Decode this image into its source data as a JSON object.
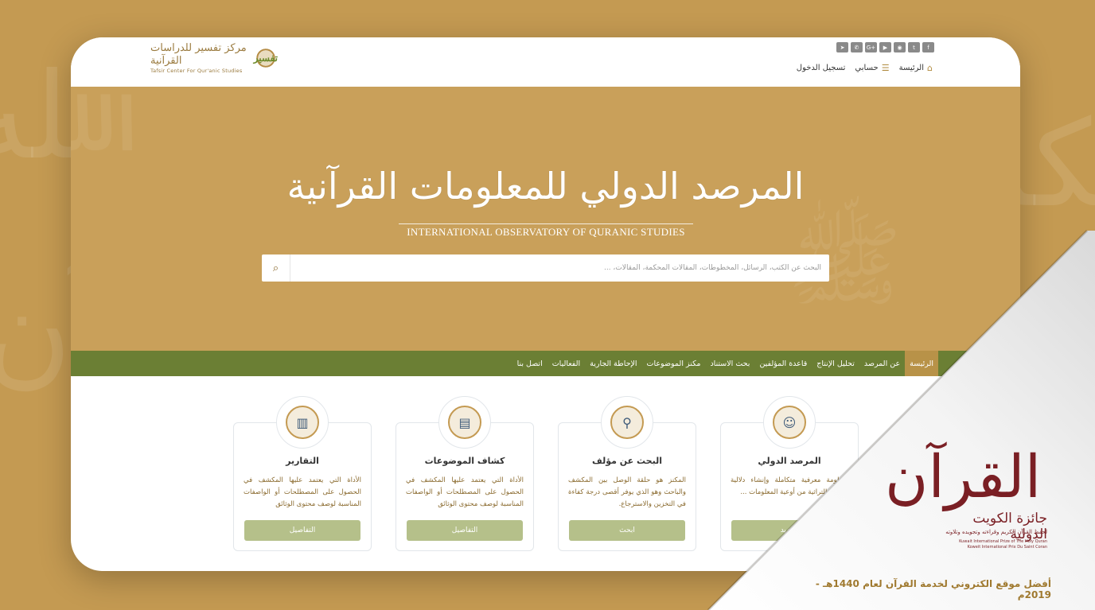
{
  "header": {
    "logo": {
      "arabic": "مركز تفسير للدراسات القرآنية",
      "english": "Tafsir Center For Qur'anic Studies",
      "emblem": "تفسير"
    },
    "social_icons": [
      "facebook-icon",
      "twitter-icon",
      "rss-icon",
      "youtube-icon",
      "google-plus-icon",
      "whatsapp-icon",
      "telegram-icon"
    ],
    "social_glyphs": {
      "facebook": "f",
      "twitter": "t",
      "rss": "◉",
      "youtube": "▶",
      "google_plus": "G+",
      "whatsapp": "✆",
      "telegram": "➤"
    },
    "links": {
      "home": "الرئيسة",
      "account": "حسابي",
      "login": "تسجيل الدخول"
    }
  },
  "hero": {
    "title_ar": "المرصد الدولي للمعلومات القرآنية",
    "title_en": "INTERNATIONAL OBSERVATORY OF QURANIC STUDIES",
    "search_placeholder": "البحث عن الكتب، الرسائل، المخطوطات، المقالات المحكمة، المقالات، ..."
  },
  "nav": {
    "items": [
      "الرئيسة",
      "عن المرصد",
      "تحليل الإنتاج",
      "قاعدة المؤلفين",
      "بحث الاستناد",
      "مكنز الموضوعات",
      "الإحاطة الجارية",
      "الفعاليات",
      "اتصل بنا"
    ]
  },
  "cards": [
    {
      "title": "المرصد الدولي",
      "desc": "منظومة معرفية متكاملة وإنشاء دلالية للأوعية التراثية من أوعية المعلومات ...",
      "button": "المزيد",
      "icon": "user-profile-icon"
    },
    {
      "title": "البحث عن مؤلف",
      "desc": "المكنز هو حلقة الوصل بين المكشف والباحث وهو الذي يوفر أقصى درجة كفاءة في التخزين والاسترجاع.",
      "button": "ابحث",
      "icon": "author-search-icon"
    },
    {
      "title": "كشاف الموضوعات",
      "desc": "الأداة التي يعتمد عليها المكشف في الحصول على المصطلحات أو الواصفات المناسبة لوصف محتوى الوثائق",
      "button": "التفاصيل",
      "icon": "notebook-icon"
    },
    {
      "title": "التقارير",
      "desc": "الأداة التي يعتمد عليها المكشف في الحصول على المصطلحات أو الواصفات المناسبة لوصف محتوى الوثائق",
      "button": "التفاصيل",
      "icon": "report-chart-icon"
    }
  ],
  "award": {
    "emblem_text": "القرآن",
    "name": "جائزة الكويت الدولية",
    "subtitle": "لحفظ القرآن الكريم وقراءته وتجويده وتلاوته",
    "english_line1": "Kuwait International Prize of The Holy Quran",
    "english_line2": "Koweit International Prix Du Saint Coran",
    "caption": "أفضل موقع الكتروني لخدمة القرآن لعام 1440هـ - 2019م"
  },
  "colors": {
    "gold": "#c49a52",
    "green_nav": "#6b7f34",
    "active_nav": "#b89248",
    "card_button": "#b5c08a",
    "prize_red": "#7a1f24"
  }
}
